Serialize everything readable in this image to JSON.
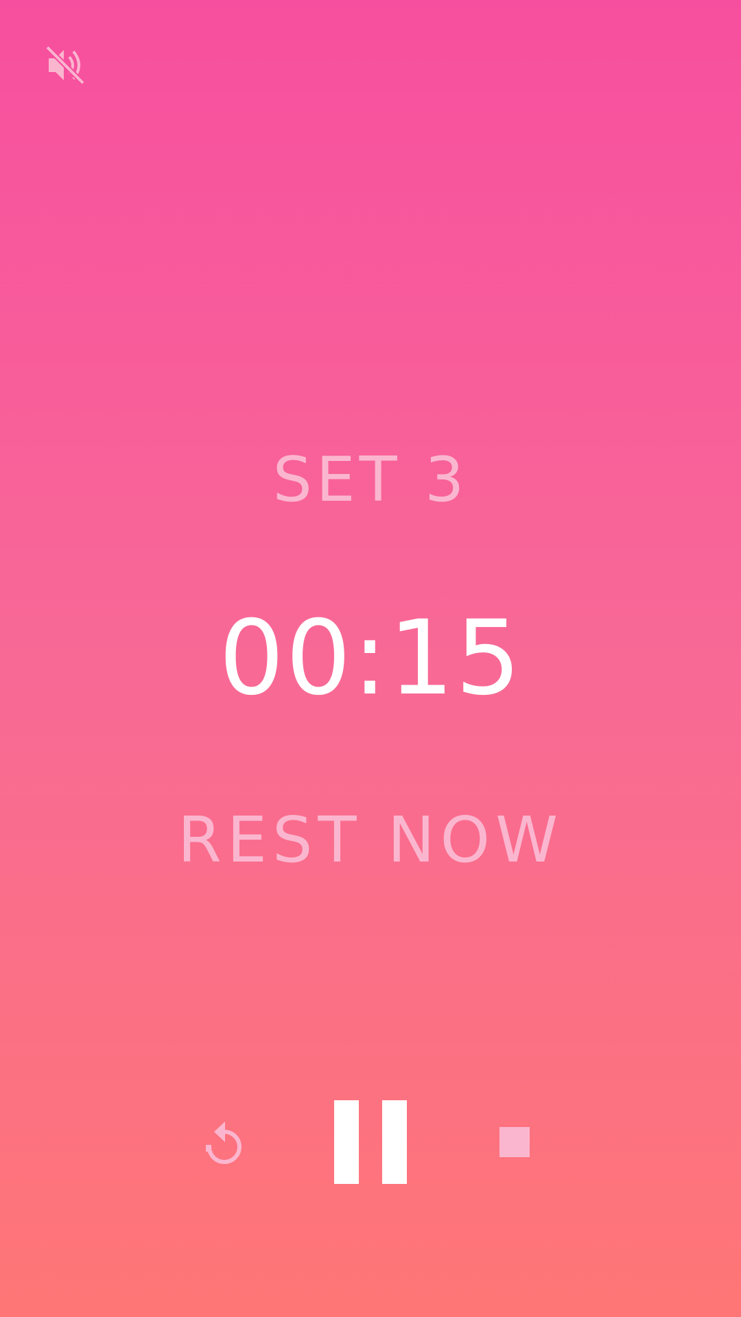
{
  "header": {
    "mute_icon": "volume-off-icon"
  },
  "workout": {
    "set_label": "SET 3",
    "timer": "00:15",
    "status": "REST NOW"
  },
  "controls": {
    "restart_icon": "restart-icon",
    "pause_icon": "pause-icon",
    "stop_icon": "stop-icon"
  },
  "colors": {
    "gradient_top": "#f74f9f",
    "gradient_bottom": "#ff7676",
    "muted_text": "#fbb6cf",
    "primary_text": "#ffffff"
  }
}
